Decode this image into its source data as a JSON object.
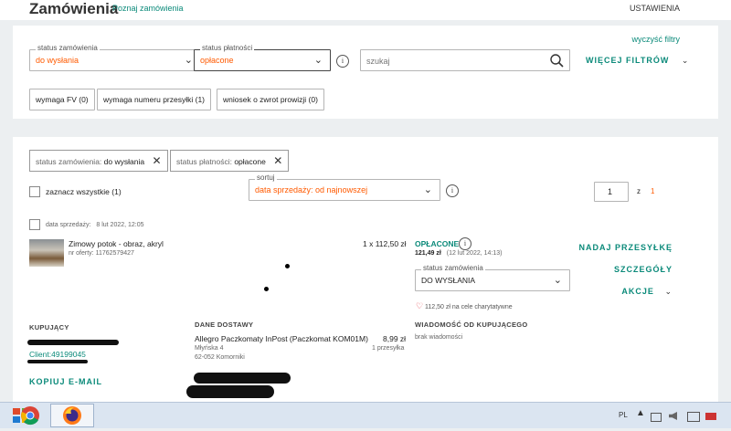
{
  "header": {
    "title": "Zamówienia",
    "learn_link": "Poznaj zamówienia",
    "settings": "USTAWIENIA"
  },
  "filters": {
    "clear": "wyczyść filtry",
    "order_status": {
      "label": "status zamówienia",
      "value": "do wysłania"
    },
    "payment_status": {
      "label": "status płatności",
      "value": "opłacone"
    },
    "search": {
      "placeholder": "szukaj"
    },
    "more": "WIĘCEJ FILTRÓW",
    "quick": [
      "wymaga FV (0)",
      "wymaga numeru przesyłki (1)",
      "wniosek o zwrot prowizji (0)"
    ]
  },
  "active_filters": [
    {
      "label": "status zamówienia:",
      "value": "do wysłania"
    },
    {
      "label": "status płatności:",
      "value": "opłacone"
    }
  ],
  "list": {
    "select_all": "zaznacz wszystkie (1)",
    "sort": {
      "label": "sortuj",
      "value": "data sprzedaży: od najnowszej"
    },
    "page": "1",
    "of": "z",
    "pages": "1"
  },
  "order": {
    "sale_date_label": "data sprzedaży:",
    "sale_date": "8 lut 2022, 12:05",
    "item_title": "Zimowy potok - obraz, akryl",
    "offer_no": "nr oferty: 11762579427",
    "qty_price": "1 x 112,50 zł",
    "payment_status": "OPŁACONE",
    "paid_amount": "121,49 zł",
    "paid_date": "(12 lut 2022, 14:13)",
    "status_label": "status zamówienia",
    "status_value": "DO WYSŁANIA",
    "charity": "112,50 zł na cele charytatywne",
    "actions": {
      "ship": "NADAJ PRZESYŁKĘ",
      "details": "SZCZEGÓŁY",
      "more": "AKCJE"
    },
    "buyer": {
      "title": "KUPUJĄCY",
      "client": "Client:49199045",
      "copy_email": "KOPIUJ E-MAIL"
    },
    "delivery": {
      "title": "DANE DOSTAWY",
      "method": "Allegro Paczkomaty InPost (Paczkomat KOM01M)",
      "price": "8,99 zł",
      "street": "Młyńska 4",
      "parcels": "1 przesyłka",
      "city": "62-052 Komorniki"
    },
    "message": {
      "title": "WIADOMOŚĆ OD KUPUJĄCEGO",
      "value": "brak wiadomości"
    }
  },
  "taskbar": {
    "lang": "PL",
    "apps": [
      "chrome-icon",
      "firefox-icon"
    ]
  },
  "colors": {
    "accent": "#0b8a7a",
    "orange": "#ff5a00"
  }
}
